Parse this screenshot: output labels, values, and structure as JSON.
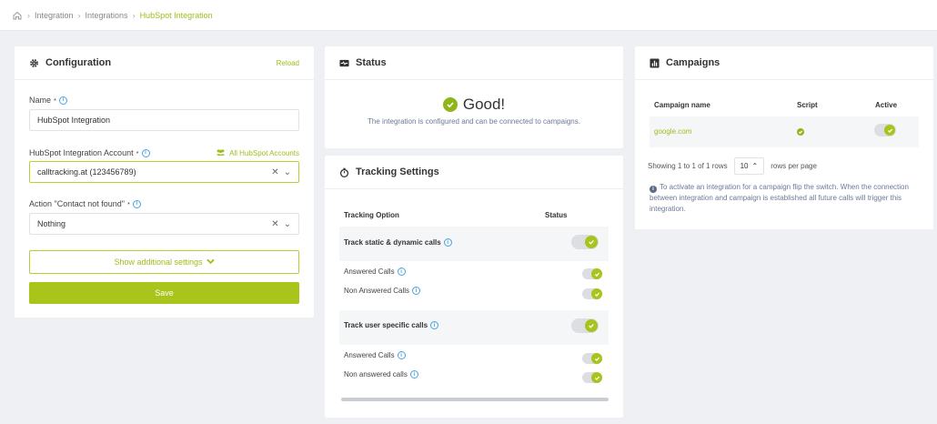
{
  "breadcrumb": {
    "items": [
      "Integration",
      "Integrations",
      "HubSpot Integration"
    ],
    "separator": "›"
  },
  "configuration": {
    "title": "Configuration",
    "reload_label": "Reload",
    "name_label": "Name",
    "name_value": "HubSpot Integration",
    "account_label": "HubSpot Integration Account",
    "all_accounts_label": "All HubSpot Accounts",
    "account_value": "calltracking.at (123456789)",
    "action_label": "Action \"Contact not found\"",
    "action_value": "Nothing",
    "additional_settings_label": "Show additional settings",
    "save_label": "Save",
    "required_mark": "*"
  },
  "status": {
    "title": "Status",
    "state": "Good!",
    "description": "The integration is configured and can be connected to campaigns."
  },
  "tracking": {
    "title": "Tracking Settings",
    "col_option": "Tracking Option",
    "col_status": "Status",
    "groups": [
      {
        "label": "Track static & dynamic calls",
        "enabled": true,
        "items": [
          {
            "label": "Answered Calls",
            "enabled": true
          },
          {
            "label": "Non Answered Calls",
            "enabled": true
          }
        ]
      },
      {
        "label": "Track user specific calls",
        "enabled": true,
        "items": [
          {
            "label": "Answered Calls",
            "enabled": true
          },
          {
            "label": "Non answered calls",
            "enabled": true
          }
        ]
      }
    ]
  },
  "campaigns": {
    "title": "Campaigns",
    "col_name": "Campaign name",
    "col_script": "Script",
    "col_active": "Active",
    "rows": [
      {
        "name": "google.com",
        "script": true,
        "active": true
      }
    ],
    "showing_text": "Showing 1 to 1 of 1 rows",
    "rows_per_page_value": "10",
    "rows_per_page_label": "rows per page",
    "note": "To activate an integration for a campaign flip the switch. When the connection between integration and campaign is established all future calls will trigger this integration."
  },
  "colors": {
    "accent": "#a9c41a",
    "link": "#9bbf1b",
    "info": "#4aa3e0"
  }
}
